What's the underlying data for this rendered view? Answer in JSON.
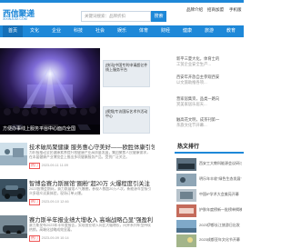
{
  "header": {
    "logo_main": "西信聚递",
    "logo_sub": "XIXINJUDI.COM",
    "search_placeholder": "关键词搜索：品牌折扣",
    "search_button": "搜索",
    "links": [
      "品牌介绍",
      "招商加盟",
      "手机版"
    ]
  },
  "nav": {
    "items": [
      "首页",
      "文化",
      "企业",
      "科技",
      "社会",
      "娱乐",
      "体育",
      "财经",
      "健康",
      "旅游",
      "教育"
    ],
    "active_index": 0
  },
  "feature": {
    "caption": "方便办事线上服务平台中心面向全国"
  },
  "side_thumbs": [
    {
      "label": "[快讯]中国专利申请超亿件 线上服务平台"
    },
    {
      "label": "[视频]专访国际艺术节活动中心"
    }
  ],
  "articles": [
    {
      "title": "技术破局聚健康 服务惠心守美好——欧胜体康引领那",
      "desc": "为积极推动全民健康素养提升和健康产业高质量发展，集团聚焦人民健康需求，在本届健康产业博览会上推出多项健康服务产品，受到广泛关注。",
      "tag": "热门",
      "date": "2023-09-11 11:09"
    },
    {
      "title": "智博会赛力斯展馆\"圈粉\"超20万 火爆程度引关注",
      "desc": "2023智博会期间，赛力斯展馆人气爆棚，参观人数超20万人次，新能源车型吸引众多观众试乘体验，现场订单火爆。",
      "tag": "热门",
      "date": "2023-09-10 12:46"
    },
    {
      "title": "赛力斯半年报业绩大增收入 高端战略凸显\"强盈利",
      "desc": "赛力斯发布2023年半年度报告，实现营业收入同比大幅增长，问界系列车型持续热销，高端化战略成效显著。",
      "tag": "热门",
      "date": "2023-09-09 10:14"
    }
  ],
  "right_list": [
    {
      "title": "新平三夏大化，体育士的",
      "sub": "工贸企业安全生产..."
    },
    {
      "title": "西安年开放自主参观西安",
      "sub": "以文旅助推各项..."
    },
    {
      "title": "营家居集资，品类一路向",
      "sub": "赏美家居乐居天..."
    },
    {
      "title": "触高花文明，成茶刊第一",
      "sub": "茶旅文化节开幕..."
    }
  ],
  "hot": {
    "title": "热文排行",
    "items": [
      "西安工大教科能源会议研讨",
      "明乐年丰收\"绿色生态发展\"",
      "中国IP学术大会美苑开幕",
      "护肤年度榜新一批榜单揭晓",
      "2023伊都长江旅游日出发",
      "2023成都亚年文化节开幕"
    ]
  }
}
